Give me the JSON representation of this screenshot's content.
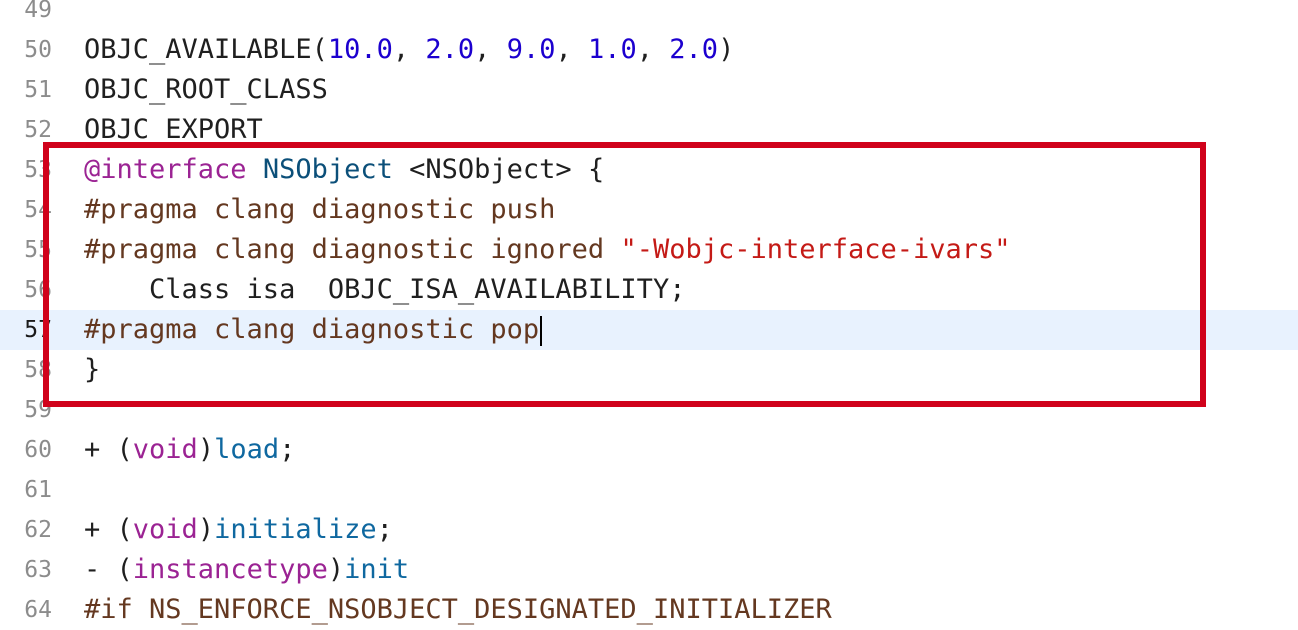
{
  "editor": {
    "current_line": "57",
    "lines": [
      {
        "num": "49",
        "tokens": []
      },
      {
        "num": "50",
        "tokens": [
          {
            "t": "OBJC_AVAILABLE(",
            "c": "plain"
          },
          {
            "t": "10.0",
            "c": "num"
          },
          {
            "t": ", ",
            "c": "plain"
          },
          {
            "t": "2.0",
            "c": "num"
          },
          {
            "t": ", ",
            "c": "plain"
          },
          {
            "t": "9.0",
            "c": "num"
          },
          {
            "t": ", ",
            "c": "plain"
          },
          {
            "t": "1.0",
            "c": "num"
          },
          {
            "t": ", ",
            "c": "plain"
          },
          {
            "t": "2.0",
            "c": "num"
          },
          {
            "t": ")",
            "c": "plain"
          }
        ]
      },
      {
        "num": "51",
        "tokens": [
          {
            "t": "OBJC_ROOT_CLASS",
            "c": "plain"
          }
        ]
      },
      {
        "num": "52",
        "tokens": [
          {
            "t": "OBJC_EXPORT",
            "c": "plain"
          }
        ]
      },
      {
        "num": "53",
        "tokens": [
          {
            "t": "@interface",
            "c": "kw"
          },
          {
            "t": " ",
            "c": "plain"
          },
          {
            "t": "NSObject",
            "c": "cls"
          },
          {
            "t": " <NSObject> {",
            "c": "plain"
          }
        ]
      },
      {
        "num": "54",
        "tokens": [
          {
            "t": "#pragma clang diagnostic push",
            "c": "pp"
          }
        ]
      },
      {
        "num": "55",
        "tokens": [
          {
            "t": "#pragma clang diagnostic ignored ",
            "c": "pp"
          },
          {
            "t": "\"-Wobjc-interface-ivars\"",
            "c": "str"
          }
        ]
      },
      {
        "num": "56",
        "tokens": [
          {
            "t": "    Class isa  OBJC_ISA_AVAILABILITY;",
            "c": "plain"
          }
        ]
      },
      {
        "num": "57",
        "tokens": [
          {
            "t": "#pragma clang diagnostic pop",
            "c": "pp"
          }
        ],
        "caret": true
      },
      {
        "num": "58",
        "tokens": [
          {
            "t": "}",
            "c": "plain"
          }
        ]
      },
      {
        "num": "59",
        "tokens": []
      },
      {
        "num": "60",
        "tokens": [
          {
            "t": "+ (",
            "c": "plain"
          },
          {
            "t": "void",
            "c": "kw"
          },
          {
            "t": ")",
            "c": "plain"
          },
          {
            "t": "load",
            "c": "fn"
          },
          {
            "t": ";",
            "c": "plain"
          }
        ]
      },
      {
        "num": "61",
        "tokens": []
      },
      {
        "num": "62",
        "tokens": [
          {
            "t": "+ (",
            "c": "plain"
          },
          {
            "t": "void",
            "c": "kw"
          },
          {
            "t": ")",
            "c": "plain"
          },
          {
            "t": "initialize",
            "c": "fn"
          },
          {
            "t": ";",
            "c": "plain"
          }
        ]
      },
      {
        "num": "63",
        "tokens": [
          {
            "t": "- (",
            "c": "plain"
          },
          {
            "t": "instancetype",
            "c": "kw"
          },
          {
            "t": ")",
            "c": "plain"
          },
          {
            "t": "init",
            "c": "fn"
          }
        ]
      },
      {
        "num": "64",
        "tokens": [
          {
            "t": "#if NS_ENFORCE_NSOBJECT_DESIGNATED_INITIALIZER",
            "c": "pp"
          }
        ]
      }
    ]
  },
  "annotation": {
    "highlight_color": "#d0021b",
    "highlighted_lines": [
      "53",
      "54",
      "55",
      "56",
      "57",
      "58"
    ]
  }
}
